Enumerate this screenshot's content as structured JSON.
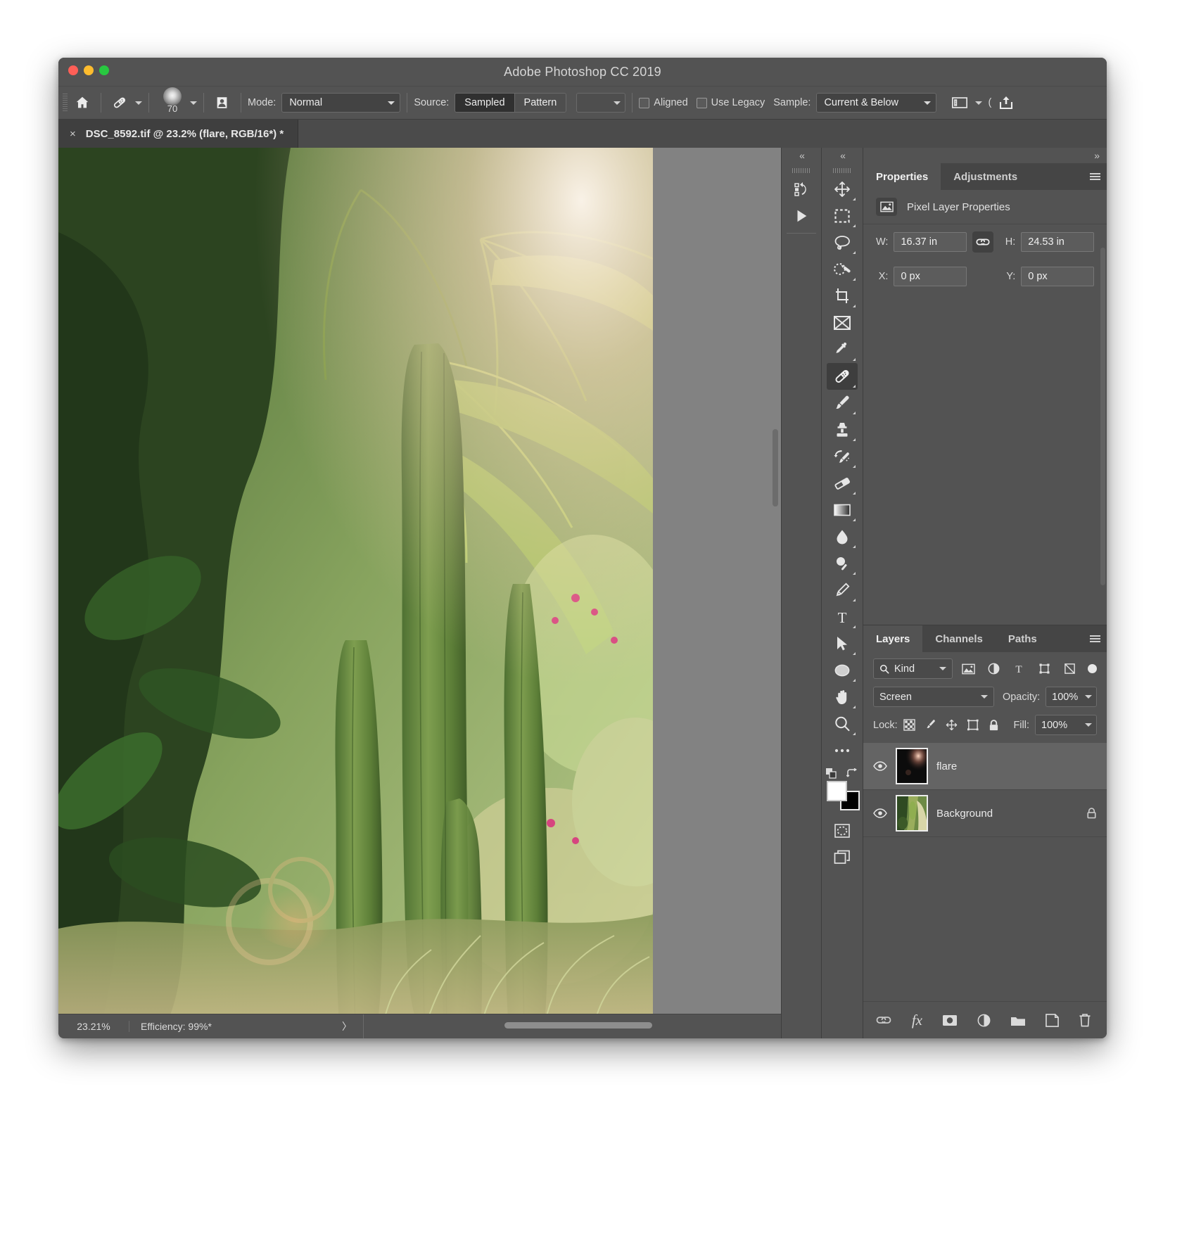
{
  "window": {
    "title": "Adobe Photoshop CC 2019",
    "traffic": {
      "close": "close-button",
      "minimize": "minimize-button",
      "zoom": "zoom-button"
    }
  },
  "options_bar": {
    "home_icon": "home-icon",
    "tool_preset_icon": "healing-brush-icon",
    "brush_size": "70",
    "pattern_icon": "clone-source-icon",
    "mode_label": "Mode:",
    "mode_value": "Normal",
    "source_label": "Source:",
    "source_sampled": "Sampled",
    "source_pattern": "Pattern",
    "aligned_label": "Aligned",
    "use_legacy_label": "Use Legacy",
    "sample_label": "Sample:",
    "sample_value": "Current & Below",
    "tablet_icon": "tablet-pressure-icon",
    "share_icon": "share-icon",
    "paren": "("
  },
  "tab": {
    "close_icon": "×",
    "title": "DSC_8592.tif @ 23.2% (flare, RGB/16*) *"
  },
  "tools": {
    "collapse_left": "«",
    "collapse_right": "«",
    "expand_right": "»",
    "history_rail": [
      "history-states-icon",
      "play-icon"
    ],
    "items": [
      {
        "name": "move-tool",
        "has_flyout": true
      },
      {
        "name": "rectangular-marquee-tool",
        "has_flyout": true
      },
      {
        "name": "lasso-tool",
        "has_flyout": true
      },
      {
        "name": "quick-selection-tool",
        "has_flyout": true
      },
      {
        "name": "crop-tool",
        "has_flyout": true
      },
      {
        "name": "frame-tool",
        "has_flyout": false
      },
      {
        "name": "eyedropper-tool",
        "has_flyout": true
      },
      {
        "name": "healing-brush-tool",
        "has_flyout": true,
        "active": true
      },
      {
        "name": "brush-tool",
        "has_flyout": true
      },
      {
        "name": "clone-stamp-tool",
        "has_flyout": true
      },
      {
        "name": "history-brush-tool",
        "has_flyout": true
      },
      {
        "name": "eraser-tool",
        "has_flyout": true
      },
      {
        "name": "gradient-tool",
        "has_flyout": true
      },
      {
        "name": "blur-tool",
        "has_flyout": true
      },
      {
        "name": "dodge-tool",
        "has_flyout": true
      },
      {
        "name": "pen-tool",
        "has_flyout": true
      },
      {
        "name": "horizontal-type-tool",
        "has_flyout": true
      },
      {
        "name": "path-selection-tool",
        "has_flyout": true
      },
      {
        "name": "ellipse-tool",
        "has_flyout": true
      },
      {
        "name": "hand-tool",
        "has_flyout": true
      },
      {
        "name": "zoom-tool",
        "has_flyout": true
      },
      {
        "name": "edit-toolbar-icon",
        "has_flyout": false
      }
    ],
    "foreground_color": "#ffffff",
    "background_color": "#000000",
    "swap_colors_icon": "swap-colors-icon",
    "default_colors_icon": "default-colors-icon",
    "quick_mask_icon": "quick-mask-icon",
    "screen_mode_icon": "screen-mode-icon"
  },
  "properties": {
    "tabs": [
      {
        "label": "Properties",
        "active": true
      },
      {
        "label": "Adjustments",
        "active": false
      }
    ],
    "menu_icon": "panel-menu-icon",
    "header_icon": "pixel-layer-icon",
    "header_title": "Pixel Layer Properties",
    "w_label": "W:",
    "w_value": "16.37 in",
    "link_icon": "link-dimensions-icon",
    "h_label": "H:",
    "h_value": "24.53 in",
    "x_label": "X:",
    "x_value": "0 px",
    "y_label": "Y:",
    "y_value": "0 px"
  },
  "layers": {
    "tabs": [
      {
        "label": "Layers",
        "active": true
      },
      {
        "label": "Channels",
        "active": false
      },
      {
        "label": "Paths",
        "active": false
      }
    ],
    "menu_icon": "panel-menu-icon",
    "filter": {
      "search_icon": "search-icon",
      "kind_label": "Kind",
      "icons": [
        "pixel-filter-icon",
        "adjustment-filter-icon",
        "type-filter-icon",
        "shape-filter-icon",
        "smart-object-filter-icon"
      ],
      "toggle": "filter-toggle"
    },
    "blend_mode": "Screen",
    "opacity_label": "Opacity:",
    "opacity_value": "100%",
    "lock_label": "Lock:",
    "lock_icons": [
      "lock-transparent-pixels-icon",
      "lock-image-pixels-icon",
      "lock-position-icon",
      "lock-artboard-nesting-icon",
      "lock-all-icon"
    ],
    "fill_label": "Fill:",
    "fill_value": "100%",
    "items": [
      {
        "name": "flare",
        "visible": true,
        "selected": true,
        "locked": false,
        "thumb_type": "flare-thumbnail"
      },
      {
        "name": "Background",
        "visible": true,
        "selected": false,
        "locked": true,
        "thumb_type": "photo-thumbnail"
      }
    ],
    "footer_icons": [
      "link-layers-icon",
      "layer-style-fx-icon",
      "add-layer-mask-icon",
      "new-adjustment-layer-icon",
      "new-group-icon",
      "new-layer-icon",
      "delete-layer-icon"
    ],
    "fx_label": "fx"
  },
  "status_bar": {
    "zoom": "23.21%",
    "efficiency": "Efficiency: 99%*",
    "expand_icon": "〉"
  },
  "colors": {
    "window_chrome": "#535353",
    "panel_bg": "#535353",
    "panel_tab_inactive": "#454545",
    "canvas_bg": "#828282",
    "field_bg": "#5c5c5c",
    "selected_layer": "#646464"
  }
}
